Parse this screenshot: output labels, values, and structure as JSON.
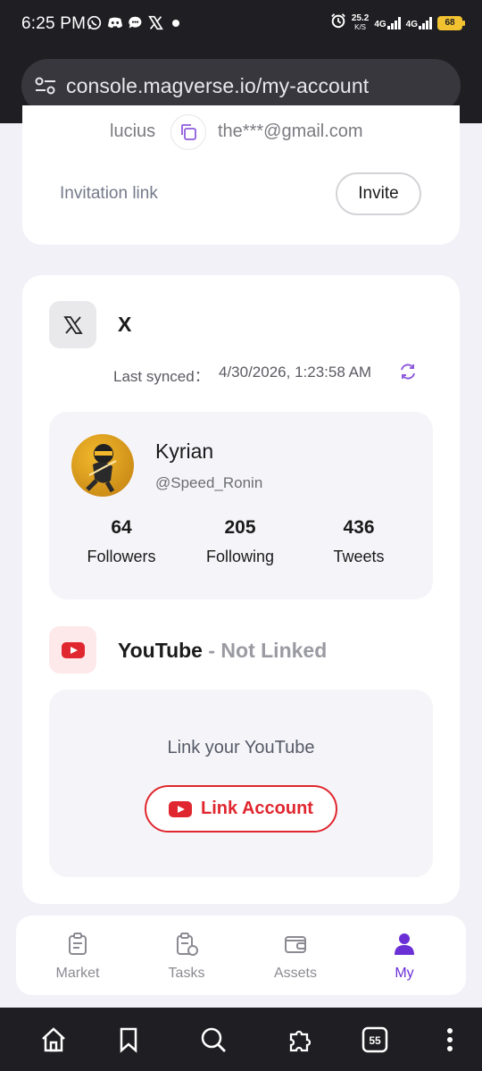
{
  "status_bar": {
    "time": "6:25 PM",
    "speed_value": "25.2",
    "speed_unit": "K/S",
    "network_1": "4G",
    "network_2": "4G",
    "battery": "68"
  },
  "browser": {
    "url": "console.magverse.io/my-account"
  },
  "account": {
    "username": "lucius",
    "email": "the***@gmail.com",
    "invitation_label": "Invitation link",
    "invite_button": "Invite"
  },
  "x_section": {
    "title": "X",
    "last_synced_label": "Last synced：",
    "last_synced_value": "4/30/2026, 1:23:58 AM",
    "profile": {
      "name": "Kyrian",
      "handle": "@Speed_Ronin",
      "stats": [
        {
          "value": "64",
          "label": "Followers"
        },
        {
          "value": "205",
          "label": "Following"
        },
        {
          "value": "436",
          "label": "Tweets"
        }
      ]
    }
  },
  "youtube_section": {
    "title": "YouTube",
    "separator": " - ",
    "status": "Not Linked",
    "prompt": "Link your YouTube",
    "link_button": "Link Account",
    "brand_color": "#e0262e"
  },
  "bottom_nav": {
    "items": [
      {
        "label": "Market",
        "icon": "market-icon"
      },
      {
        "label": "Tasks",
        "icon": "tasks-icon"
      },
      {
        "label": "Assets",
        "icon": "wallet-icon"
      },
      {
        "label": "My",
        "icon": "user-icon"
      }
    ],
    "active_color": "#6b2fd6"
  },
  "system_nav": {
    "tabs_count": "55"
  }
}
